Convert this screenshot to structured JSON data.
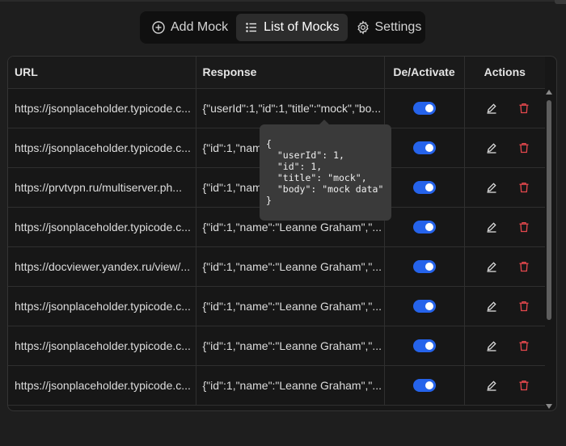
{
  "tabs": [
    {
      "label": "Add Mock",
      "icon": "plus-circle-icon",
      "active": false
    },
    {
      "label": "List of Mocks",
      "icon": "list-icon",
      "active": true
    },
    {
      "label": "Settings",
      "icon": "gear-icon",
      "active": false
    }
  ],
  "table": {
    "headers": {
      "url": "URL",
      "response": "Response",
      "toggle": "De/Activate",
      "actions": "Actions"
    },
    "rows": [
      {
        "url": "https://jsonplaceholder.typicode.c...",
        "response": "{\"userId\":1,\"id\":1,\"title\":\"mock\",\"bo...",
        "active": true
      },
      {
        "url": "https://jsonplaceholder.typicode.c...",
        "response": "{\"id\":1,\"name\":\"Leanne Graham\",\"...",
        "active": true
      },
      {
        "url": "https://prvtvpn.ru/multiserver.ph...",
        "response": "{\"id\":1,\"name\":\"Leanne Graham\",\"...",
        "active": true
      },
      {
        "url": "https://jsonplaceholder.typicode.c...",
        "response": "{\"id\":1,\"name\":\"Leanne Graham\",\"...",
        "active": true
      },
      {
        "url": "https://docviewer.yandex.ru/view/...",
        "response": "{\"id\":1,\"name\":\"Leanne Graham\",\"...",
        "active": true
      },
      {
        "url": "https://jsonplaceholder.typicode.c...",
        "response": "{\"id\":1,\"name\":\"Leanne Graham\",\"...",
        "active": true
      },
      {
        "url": "https://jsonplaceholder.typicode.c...",
        "response": "{\"id\":1,\"name\":\"Leanne Graham\",\"...",
        "active": true
      },
      {
        "url": "https://jsonplaceholder.typicode.c...",
        "response": "{\"id\":1,\"name\":\"Leanne Graham\",\"...",
        "active": true
      }
    ]
  },
  "tooltip": {
    "text": "{\n  \"userId\": 1,\n  \"id\": 1,\n  \"title\": \"mock\",\n  \"body\": \"mock data\"\n}"
  },
  "colors": {
    "toggle_on": "#2563eb",
    "delete": "#e5484d",
    "background": "#1e1e1e"
  }
}
